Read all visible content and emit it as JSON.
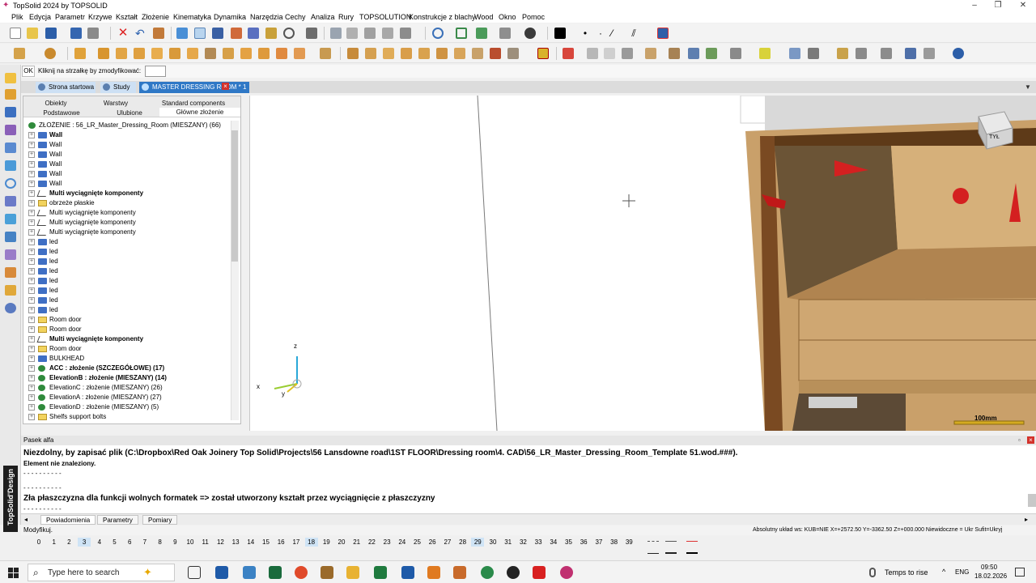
{
  "app": {
    "title": "TopSolid 2024 by TOPSOLID",
    "window_buttons": [
      "–",
      "❐",
      "✕"
    ]
  },
  "menu": [
    "Plik",
    "Edycja",
    "Parametr",
    "Krzywe",
    "Kształt",
    "Złożenie",
    "Kinematyka",
    "Dynamika",
    "Narzędzia",
    "Cechy",
    "Analiza",
    "Rury",
    "TOPSOLUTION",
    "Konstrukcje z blachy",
    "Wood",
    "Okno",
    "Pomoc"
  ],
  "command": {
    "ok_label": "OK",
    "prompt": "Kliknij na strzałkę by zmodyfikować:",
    "value": ""
  },
  "doc_tabs": {
    "home": "Strona startowa",
    "study": "Study",
    "master": "MASTER DRESSING ROOM * 1",
    "close": "×"
  },
  "tree_tabs": {
    "row1": [
      "Obiekty",
      "Warstwy",
      "Standard components"
    ],
    "row2": [
      "Podstawowe",
      "Ulubione",
      "Główne złożenie"
    ]
  },
  "tree": {
    "root": "ZŁOŻENIE : 56_LR_Master_Dressing_Room (MIESZANY) (66)",
    "nodes": [
      {
        "label": "Wall",
        "icon": "component-icon",
        "bold": true
      },
      {
        "label": "Wall",
        "icon": "component-icon"
      },
      {
        "label": "Wall",
        "icon": "component-icon"
      },
      {
        "label": "Wall",
        "icon": "component-icon"
      },
      {
        "label": "Wall",
        "icon": "component-icon"
      },
      {
        "label": "Wall",
        "icon": "component-icon"
      },
      {
        "label": "Multi wyciągnięte komponenty",
        "icon": "extrude-icon",
        "bold": true
      },
      {
        "label": "obrzeże płaskie",
        "icon": "folder-icon"
      },
      {
        "label": "Multi wyciągnięte komponenty",
        "icon": "extrude-icon"
      },
      {
        "label": "Multi wyciągnięte komponenty",
        "icon": "extrude-icon"
      },
      {
        "label": "Multi wyciągnięte komponenty",
        "icon": "extrude-icon"
      },
      {
        "label": "led",
        "icon": "component-icon"
      },
      {
        "label": "led",
        "icon": "component-icon"
      },
      {
        "label": "led",
        "icon": "component-icon"
      },
      {
        "label": "led",
        "icon": "component-icon"
      },
      {
        "label": "led",
        "icon": "component-icon"
      },
      {
        "label": "led",
        "icon": "component-icon"
      },
      {
        "label": "led",
        "icon": "component-icon"
      },
      {
        "label": "led",
        "icon": "component-icon"
      },
      {
        "label": "Room door",
        "icon": "folder-icon"
      },
      {
        "label": "Room door",
        "icon": "folder-icon"
      },
      {
        "label": "Multi wyciągnięte komponenty",
        "icon": "extrude-icon",
        "bold": true
      },
      {
        "label": "Room door",
        "icon": "folder-icon"
      },
      {
        "label": "BULKHEAD",
        "icon": "component-icon"
      },
      {
        "label": "ACC : złożenie (SZCZEGÓŁOWE) (17)",
        "icon": "assembly-icon",
        "bold": true
      },
      {
        "label": "ElevationB : złożenie (MIESZANY) (14)",
        "icon": "assembly-icon",
        "bold": true
      },
      {
        "label": "ElevationC : złożenie (MIESZANY) (26)",
        "icon": "assembly-icon"
      },
      {
        "label": "ElevationA : złożenie (MIESZANY) (27)",
        "icon": "assembly-icon"
      },
      {
        "label": "ElevationD : złożenie (MIESZANY) (5)",
        "icon": "assembly-icon"
      },
      {
        "label": "Shelfs support bolts",
        "icon": "folder-icon"
      }
    ]
  },
  "viewport": {
    "scale_label": "100mm",
    "axis": {
      "z": "z",
      "y": "y",
      "x": "x"
    },
    "viewcube_label": "TYŁ"
  },
  "messages": {
    "header": "Pasek alfa",
    "lines": [
      {
        "text": "Niezdolny, by zapisać plik (C:\\Dropbox\\Red Oak Joinery Top Solid\\Projects\\56 Lansdowne road\\1ST FLOOR\\Dressing room\\4. CAD\\56_LR_Master_Dressing_Room_Template 51.wod.###).",
        "style": "b"
      },
      {
        "text": "Element nie znaleziony.",
        "style": "bs"
      },
      {
        "text": "- - - - - - - - - -",
        "style": "s"
      },
      {
        "text": "- - - - - - - - - -",
        "style": "s"
      },
      {
        "text": "Zła płaszczyzna dla funkcji wolnych formatek => został utworzony kształt przez wyciągnięcie z płaszczyzny",
        "style": "b"
      },
      {
        "text": "- - - - - - - - - -",
        "style": "s"
      }
    ],
    "tabs": [
      "Powiadomienia",
      "Parametry",
      "Pomiary"
    ]
  },
  "status": {
    "left": "Modyfikuj.",
    "right": "Absolutny układ ws: KUB=NIE  X=+2572.50  Y=-3362.50  Z=+000.000  Niewidoczne = Ukr  Sufit=Ukryj"
  },
  "layers": {
    "numbers": [
      "0",
      "1",
      "2",
      "3",
      "4",
      "5",
      "6",
      "7",
      "8",
      "9",
      "10",
      "11",
      "12",
      "13",
      "14",
      "15",
      "16",
      "17",
      "18",
      "19",
      "20",
      "21",
      "22",
      "23",
      "24",
      "25",
      "26",
      "27",
      "28",
      "29",
      "30",
      "31",
      "32",
      "33",
      "34",
      "35",
      "36",
      "37",
      "38",
      "39"
    ],
    "highlighted": [
      "3",
      "18",
      "29"
    ]
  },
  "taskbar": {
    "search_placeholder": "Type here to search",
    "weather": "Temps to rise",
    "language": "ENG",
    "time": "09:50",
    "date": "18.02.2026"
  },
  "colors": {
    "accent_tab": "#2f78c6",
    "close_red": "#d3312b",
    "wood": "#c9a06a",
    "wood_dark": "#7a4a22",
    "brand": "#1d1d1d"
  },
  "brand_label": "TopSolid'Design"
}
